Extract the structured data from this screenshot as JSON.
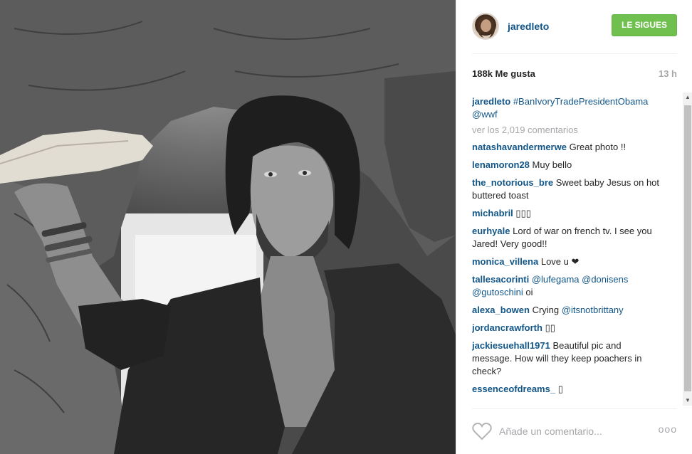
{
  "post": {
    "author": "jaredleto",
    "follow_label": "LE SIGUES",
    "likes": "188k Me gusta",
    "time": "13 h",
    "caption_user": "jaredleto",
    "caption_text": "#BanIvoryTradePresidentObama @wwf",
    "view_all": "ver los 2,019 comentarios"
  },
  "comments": [
    {
      "user": "natashavandermerwe",
      "text": "Great photo !!"
    },
    {
      "user": "lenamoron28",
      "text": "Muy bello"
    },
    {
      "user": "the_notorious_bre",
      "text": "Sweet baby Jesus on hot buttered toast"
    },
    {
      "user": "michabril",
      "text": "▯▯▯"
    },
    {
      "user": "eurhyale",
      "text": "Lord of war on french tv. I see you Jared! Very good!!"
    },
    {
      "user": "monica_villena",
      "text": "Love u ❤"
    },
    {
      "user": "tallesacorinti",
      "text": "",
      "mention": "@lufegama @donisens @gutoschini",
      "tail": " oi"
    },
    {
      "user": "alexa_bowen",
      "text": "Crying ",
      "mention": "@itsnotbrittany",
      "tail": ""
    },
    {
      "user": "jordancrawforth",
      "text": "▯▯"
    },
    {
      "user": "jackiesuehall1971",
      "text": "Beautiful pic and message. How will they keep poachers in check?"
    },
    {
      "user": "essenceofdreams_",
      "text": "▯"
    }
  ],
  "footer": {
    "placeholder": "Añade un comentario...",
    "more": "ooo"
  },
  "icons": {
    "like": "heart-outline-icon",
    "options": "more-options-icon",
    "scroll_up": "scroll-up-arrow",
    "scroll_down": "scroll-down-arrow"
  },
  "colors": {
    "link": "#125688",
    "follow": "#70c050",
    "muted": "#a5a7aa"
  }
}
